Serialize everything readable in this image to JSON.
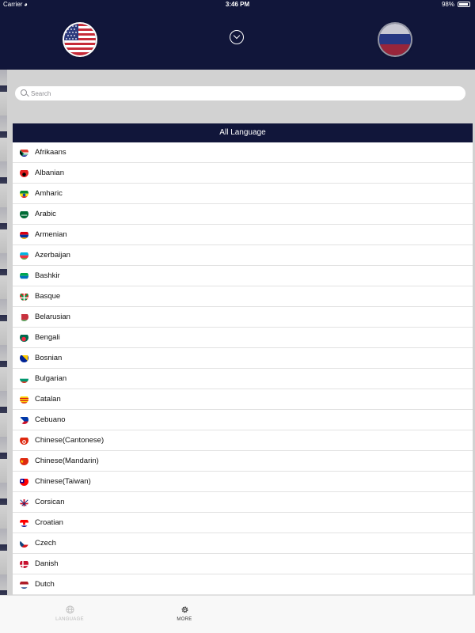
{
  "status_bar": {
    "carrier": "Carrier",
    "time": "3:46 PM",
    "battery": "98%"
  },
  "header": {
    "source_flag": "us-flag-icon",
    "target_flag": "ru-flag-icon",
    "swap_icon": "chevron-down-circle-icon"
  },
  "search": {
    "placeholder": "Search",
    "value": ""
  },
  "list": {
    "header": "All Language",
    "items": [
      {
        "label": "Afrikaans"
      },
      {
        "label": "Albanian"
      },
      {
        "label": "Amharic"
      },
      {
        "label": "Arabic"
      },
      {
        "label": "Armenian"
      },
      {
        "label": "Azerbaijan"
      },
      {
        "label": "Bashkir"
      },
      {
        "label": "Basque"
      },
      {
        "label": "Belarusian"
      },
      {
        "label": "Bengali"
      },
      {
        "label": "Bosnian"
      },
      {
        "label": "Bulgarian"
      },
      {
        "label": "Catalan"
      },
      {
        "label": "Cebuano"
      },
      {
        "label": "Chinese(Cantonese)"
      },
      {
        "label": "Chinese(Mandarin)"
      },
      {
        "label": "Chinese(Taiwan)"
      },
      {
        "label": "Corsican"
      },
      {
        "label": "Croatian"
      },
      {
        "label": "Czech"
      },
      {
        "label": "Danish"
      },
      {
        "label": "Dutch"
      }
    ]
  },
  "tabs": [
    {
      "label": "LANGUAGE",
      "icon": "globe-icon",
      "active": false
    },
    {
      "label": "MORE",
      "icon": "gear-icon",
      "active": true
    }
  ],
  "colors": {
    "header_bg": "#11163a",
    "background": "#d2d2d2",
    "tab_inactive": "#b8b8b8"
  }
}
